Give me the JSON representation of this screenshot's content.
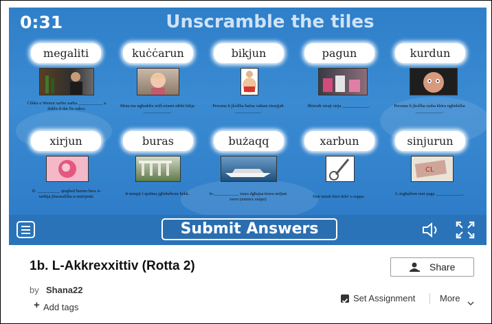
{
  "game": {
    "timer": "0:31",
    "title": "Unscramble the tiles",
    "tiles_row1": [
      "megaliti",
      "kuċċarun",
      "bikjun",
      "pagun",
      "kurdun"
    ],
    "tiles_row2": [
      "xirjun",
      "buras",
      "bużaqq",
      "xarbun",
      "sinjurun"
    ],
    "captions_row1": [
      "Ċikku u Wenzu xarbu xarba ___________ u daħlu d-dar fis-sakra.",
      "Meta ma ngħaddix mill-eżami nibki bikja ____________.",
      "Persuna li jkollha ħafna xaħam tissejjaħ ___________.",
      "Ilbieraħ xtrajt xirja ____________.",
      "Persuna li jkollha rasha kbira ngħidulha ____________."
    ],
    "captions_row2": [
      "Il- __________ qiegħed ħemm biex it-tarbija jitwasslilha n-nutrijenti.",
      "It-tempji l-qodma jgħidulhom hekk.",
      "Is-___________ xtara dgħajsa tiswa miljun ewro (miniex sinjur)",
      "Dan tużah biex titfa' s-soppa.",
      "L-ingħallem tani paga ____________."
    ],
    "submit_label": "Submit Answers"
  },
  "activity": {
    "title": "1b. L-Akkrexxittiv (Rotta 2)",
    "by_label": "by",
    "author": "Shana22",
    "add_tags_label": "Add tags",
    "share_label": "Share",
    "set_assignment_label": "Set Assignment",
    "more_label": "More"
  },
  "colors": {
    "game_background": "#3a8bd2",
    "toolbar": "#2b73b8",
    "tile": "#ffffff"
  },
  "icons": [
    "hamburger-menu-icon",
    "speaker-icon",
    "fullscreen-icon",
    "user-plus-icon",
    "checkbox-icon",
    "chevron-down-icon",
    "plus-icon"
  ]
}
